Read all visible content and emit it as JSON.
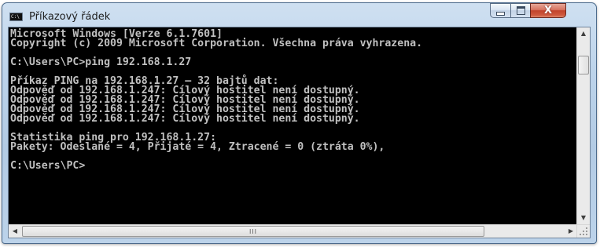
{
  "window": {
    "title": "Příkazový řádek",
    "icon": "cmd-icon",
    "icon_text": "C:\\",
    "controls": {
      "minimize_icon": "minimize-icon",
      "maximize_icon": "maximize-icon",
      "close_icon": "close-icon",
      "close_glyph": "X"
    }
  },
  "console": {
    "background": "#000000",
    "foreground": "#c0c0c0",
    "lines": [
      "Microsoft Windows [Verze 6.1.7601]",
      "Copyright (c) 2009 Microsoft Corporation. Všechna práva vyhrazena.",
      "",
      "C:\\Users\\PC>ping 192.168.1.27",
      "",
      "Příkaz PING na 192.168.1.27 – 32 bajtů dat:",
      "Odpověď od 192.168.1.247: Cílový hostitel není dostupný.",
      "Odpověď od 192.168.1.247: Cílový hostitel není dostupný.",
      "Odpověď od 192.168.1.247: Cílový hostitel není dostupný.",
      "Odpověď od 192.168.1.247: Cílový hostitel není dostupný.",
      "",
      "Statistika ping pro 192.168.1.27:",
      "Pakety: Odeslané = 4, Přijaté = 4, Ztracené = 0 (ztráta 0%),",
      "",
      "C:\\Users\\PC>"
    ]
  },
  "scrollbars": {
    "vertical": {
      "up_arrow": "▲",
      "down_arrow": "▼"
    },
    "horizontal": {
      "left_arrow": "◀",
      "right_arrow": "▶",
      "thumb_grip": "III"
    }
  }
}
